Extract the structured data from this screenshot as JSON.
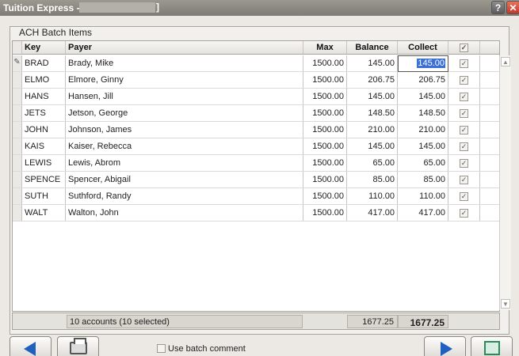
{
  "window": {
    "title": "Tuition Express -",
    "title_bracket": "]",
    "help_label": "?",
    "close_label": "✕"
  },
  "group_title": "ACH Batch Items",
  "columns": {
    "key": "Key",
    "payer": "Payer",
    "max": "Max",
    "balance": "Balance",
    "collect": "Collect"
  },
  "rows": [
    {
      "key": "BRAD",
      "payer": "Brady, Mike",
      "max": "1500.00",
      "balance": "145.00",
      "collect": "145.00",
      "checked": true,
      "editing": true
    },
    {
      "key": "ELMO",
      "payer": "Elmore, Ginny",
      "max": "1500.00",
      "balance": "206.75",
      "collect": "206.75",
      "checked": true
    },
    {
      "key": "HANS",
      "payer": "Hansen, Jill",
      "max": "1500.00",
      "balance": "145.00",
      "collect": "145.00",
      "checked": true
    },
    {
      "key": "JETS",
      "payer": "Jetson, George",
      "max": "1500.00",
      "balance": "148.50",
      "collect": "148.50",
      "checked": true
    },
    {
      "key": "JOHN",
      "payer": "Johnson, James",
      "max": "1500.00",
      "balance": "210.00",
      "collect": "210.00",
      "checked": true
    },
    {
      "key": "KAIS",
      "payer": "Kaiser, Rebecca",
      "max": "1500.00",
      "balance": "145.00",
      "collect": "145.00",
      "checked": true
    },
    {
      "key": "LEWIS",
      "payer": "Lewis, Abrom",
      "max": "1500.00",
      "balance": "65.00",
      "collect": "65.00",
      "checked": true
    },
    {
      "key": "SPENCE",
      "payer": "Spencer, Abigail",
      "max": "1500.00",
      "balance": "85.00",
      "collect": "85.00",
      "checked": true
    },
    {
      "key": "SUTH",
      "payer": "Suthford, Randy",
      "max": "1500.00",
      "balance": "110.00",
      "collect": "110.00",
      "checked": true
    },
    {
      "key": "WALT",
      "payer": "Walton, John",
      "max": "1500.00",
      "balance": "417.00",
      "collect": "417.00",
      "checked": true
    }
  ],
  "summary": {
    "accounts": "10 accounts (10 selected)",
    "balance_total": "1677.25",
    "collect_total": "1677.25"
  },
  "batch_comment_label": "Use batch comment",
  "icons": {
    "prev": "arrow-left-icon",
    "print": "printer-icon",
    "next": "arrow-right-icon",
    "done": "finish-icon",
    "row_edit": "pencil-icon"
  },
  "colors": {
    "accent": "#1f5fbf",
    "selection": "#3a6fd8",
    "close": "#c0392b"
  }
}
